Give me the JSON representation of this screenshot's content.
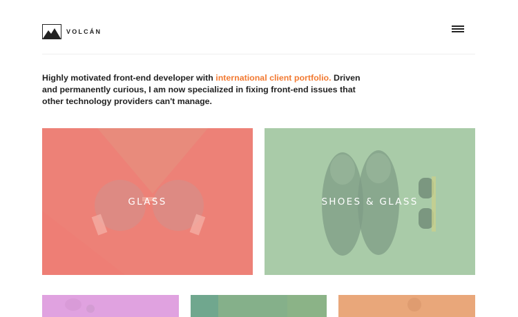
{
  "brand": {
    "name": "VOLCÁN"
  },
  "intro": {
    "before": "Highly motivated front-end developer with ",
    "link": "international client portfolio.",
    "after": " Driven and permanently curious, I am now specialized in fixing front-end issues that other technology providers can't manage."
  },
  "portfolio": {
    "items": [
      {
        "label": "GLASS",
        "color": "#ed8177"
      },
      {
        "label": "SHOES & GLASS",
        "color": "#a9cba8"
      },
      {
        "label": "",
        "color": "#e0a2e0"
      },
      {
        "label": "",
        "color": "#85b08a"
      },
      {
        "label": "",
        "color": "#e9a77a"
      }
    ]
  },
  "colors": {
    "accent": "#f27a32",
    "text": "#222222"
  }
}
